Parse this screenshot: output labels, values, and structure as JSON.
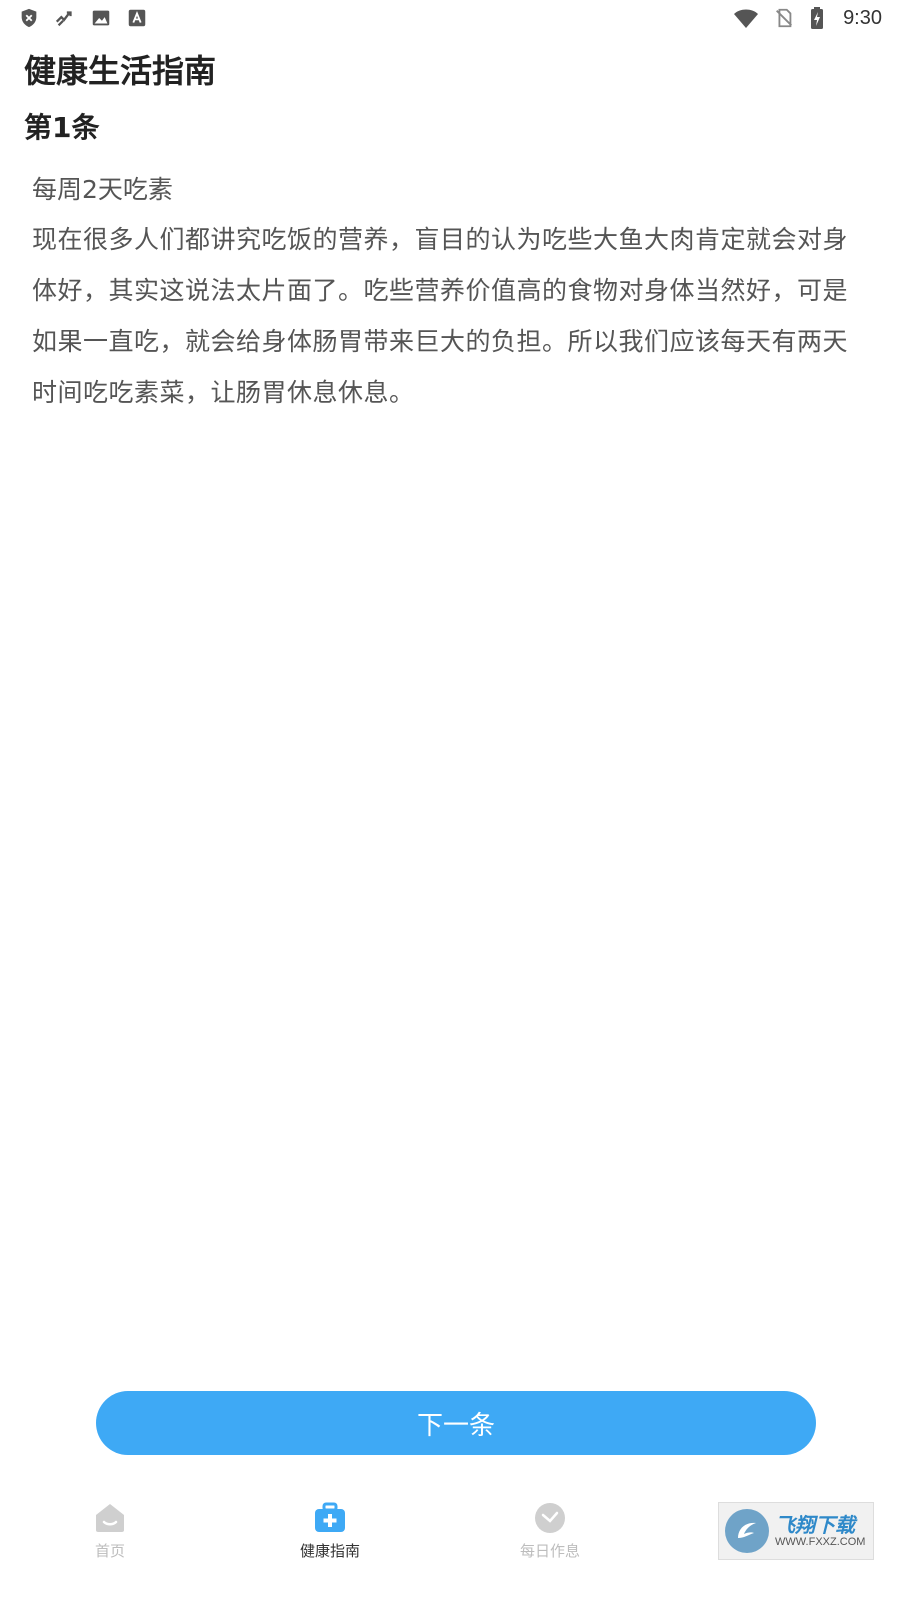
{
  "status_bar": {
    "time": "9:30",
    "left_icons": [
      "shield-x-icon",
      "activity-icon",
      "image-icon",
      "a-font-icon"
    ],
    "right_icons": [
      "wifi-icon",
      "no-sim-icon",
      "battery-charging-icon"
    ]
  },
  "page": {
    "title": "健康生活指南",
    "item_number": "第1条",
    "item_heading": "每周2天吃素",
    "item_body": "现在很多人们都讲究吃饭的营养，盲目的认为吃些大鱼大肉肯定就会对身体好，其实这说法太片面了。吃些营养价值高的食物对身体当然好，可是如果一直吃，就会给身体肠胃带来巨大的负担。所以我们应该每天有两天时间吃吃素菜，让肠胃休息休息。"
  },
  "next_button": {
    "label": "下一条"
  },
  "bottom_nav": {
    "items": [
      {
        "label": "首页",
        "icon": "home-icon",
        "active": false
      },
      {
        "label": "健康指南",
        "icon": "medical-kit-icon",
        "active": true
      },
      {
        "label": "每日作息",
        "icon": "clock-icon",
        "active": false
      }
    ]
  },
  "watermark": {
    "title": "飞翔下载",
    "url": "WWW.FXXZ.COM"
  },
  "colors": {
    "accent": "#3ea9f5",
    "nav_inactive": "#bdbdbd",
    "nav_active_text": "#333333"
  }
}
